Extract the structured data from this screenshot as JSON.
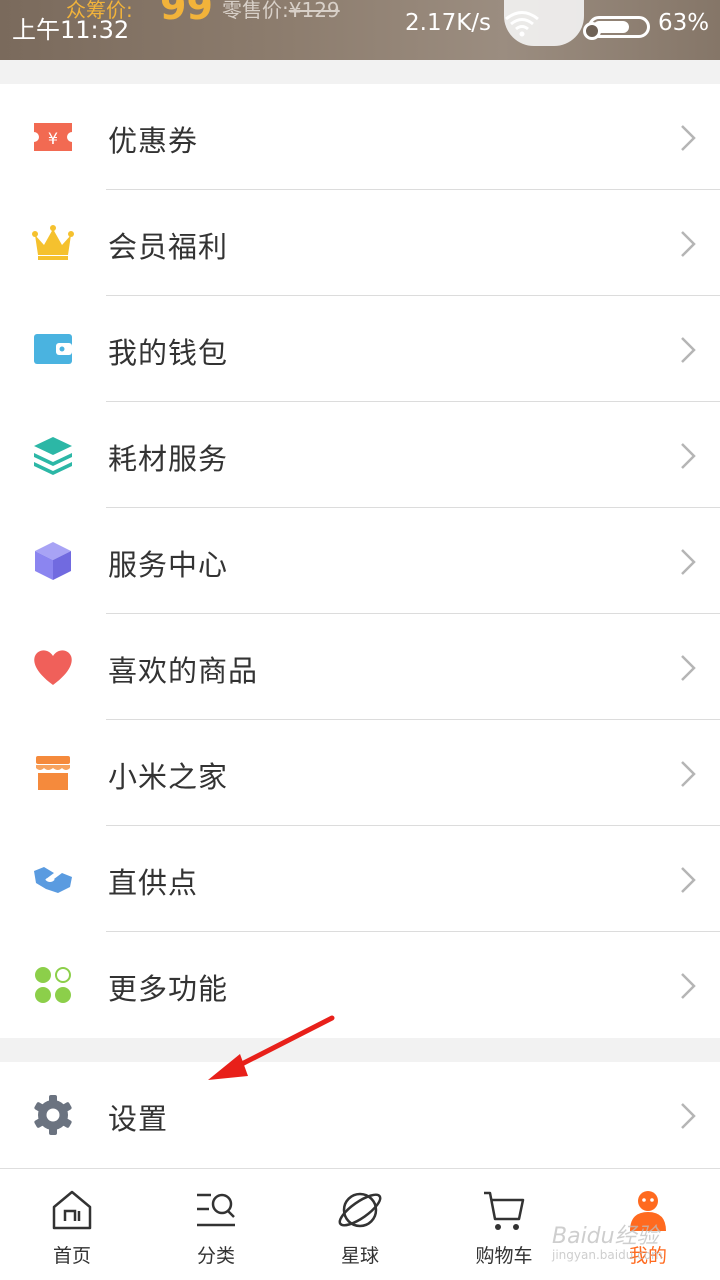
{
  "status_bar": {
    "time": "上午11:32",
    "net_speed": "2.17K/s",
    "battery": "63%"
  },
  "promo_banner": {
    "label": "众筹价:",
    "price": "99",
    "retail_label": "零售价:",
    "retail_price": "¥129"
  },
  "menu": {
    "items": [
      {
        "label": "优惠券",
        "icon": "coupon-icon",
        "color": "#f26a52"
      },
      {
        "label": "会员福利",
        "icon": "crown-icon",
        "color": "#f5c12e"
      },
      {
        "label": "我的钱包",
        "icon": "wallet-icon",
        "color": "#4ab3e0"
      },
      {
        "label": "耗材服务",
        "icon": "layers-icon",
        "color": "#2cb7a6"
      },
      {
        "label": "服务中心",
        "icon": "cube-icon",
        "color": "#8b85f0"
      },
      {
        "label": "喜欢的商品",
        "icon": "heart-icon",
        "color": "#f0605a"
      },
      {
        "label": "小米之家",
        "icon": "store-icon",
        "color": "#f58a3c"
      },
      {
        "label": "直供点",
        "icon": "handshake-icon",
        "color": "#5a9be0"
      },
      {
        "label": "更多功能",
        "icon": "more-dots-icon",
        "color": "#8ccf4a"
      }
    ],
    "settings": {
      "label": "设置",
      "icon": "gear-icon",
      "color": "#6b7380"
    }
  },
  "bottom_nav": {
    "items": [
      {
        "label": "首页",
        "icon": "home-icon"
      },
      {
        "label": "分类",
        "icon": "category-search-icon"
      },
      {
        "label": "星球",
        "icon": "planet-icon"
      },
      {
        "label": "购物车",
        "icon": "cart-icon"
      },
      {
        "label": "我的",
        "icon": "profile-icon",
        "active": true
      }
    ]
  },
  "watermark": {
    "text": "Baidu经验",
    "sub": "jingyan.baidu.com"
  },
  "colors": {
    "accent": "#ff6a1f",
    "annotation_arrow": "#e8201a"
  }
}
